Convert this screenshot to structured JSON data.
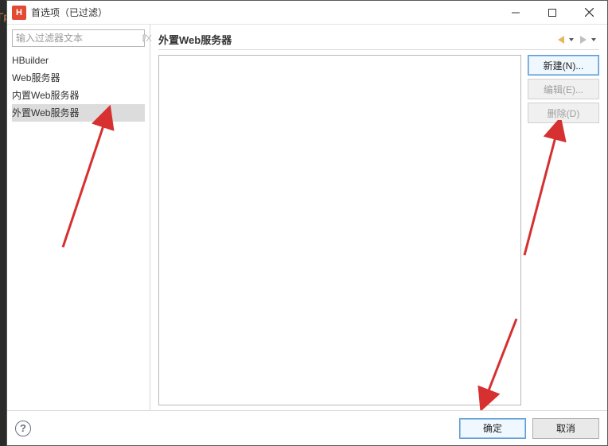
{
  "window": {
    "title": "首选项（已过滤）",
    "app_icon_letter": "H"
  },
  "filter": {
    "placeholder": "输入过滤器文本",
    "value": ""
  },
  "tree": {
    "root": "HBuilder",
    "child": "Web服务器",
    "grand1": "内置Web服务器",
    "grand2": "外置Web服务器"
  },
  "section": {
    "title": "外置Web服务器"
  },
  "buttons": {
    "new": "新建(N)...",
    "edit": "编辑(E)...",
    "delete": "删除(D)"
  },
  "footer": {
    "ok": "确定",
    "cancel": "取消"
  }
}
